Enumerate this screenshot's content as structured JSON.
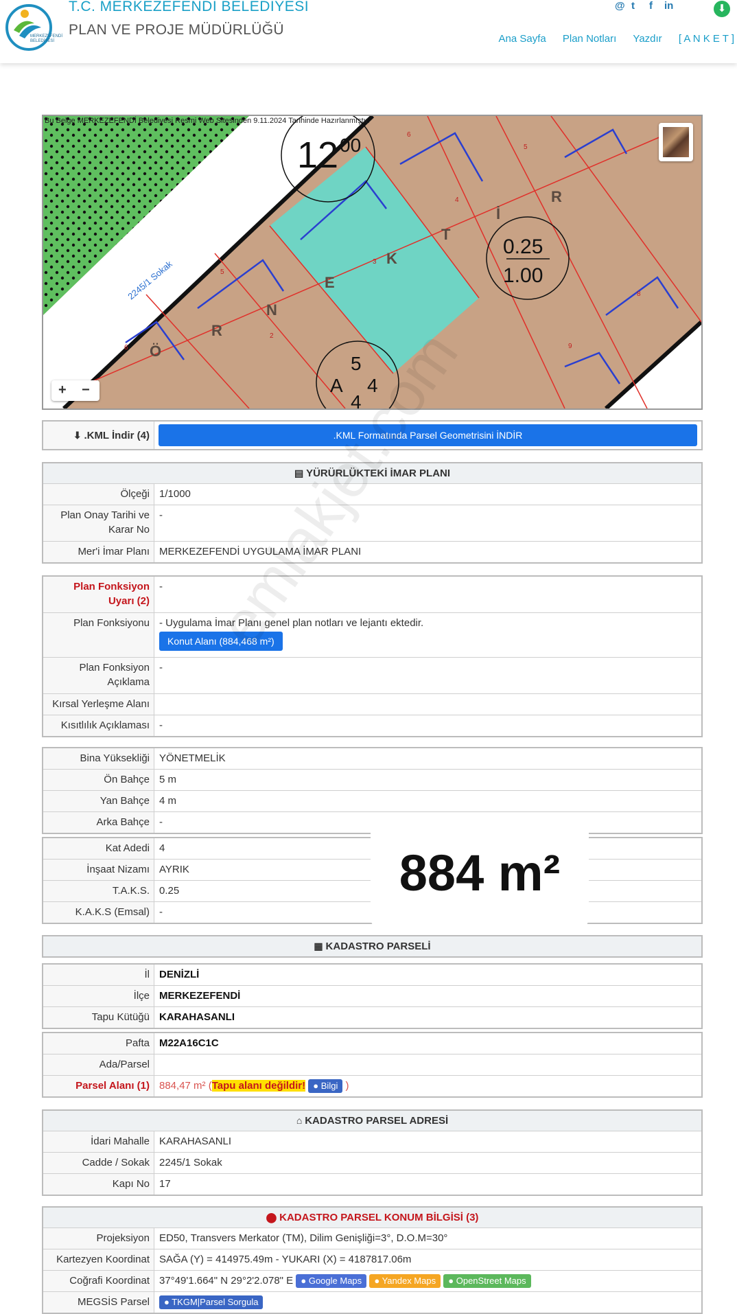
{
  "header": {
    "org_title": "T.C. MERKEZEFENDİ BELEDİYESİ",
    "org_subtitle": "PLAN VE PROJE MÜDÜRLÜĞÜ",
    "logo_text": "MERKEZEFENDİ BELEDİYESİ",
    "social": [
      "@",
      "t",
      "f",
      "in"
    ],
    "nav": [
      "Ana Sayfa",
      "Plan Notları",
      "Yazdır",
      "[ A N K E T ]"
    ]
  },
  "map": {
    "note": "Bu Belge MERKEZEFENDİ Belediyesi Resmi Web Sitesinden 9.11.2024 Tarihinde Hazırlanmıştır.",
    "street_label": "2245/1 Sokak",
    "road_width": "12",
    "road_width_sup": "00",
    "taks": "0.25",
    "kaks": "1.00",
    "block_top": "5",
    "block_left": "A",
    "block_right": "4",
    "block_bottom": "4",
    "letters": [
      "Ö",
      "R",
      "N",
      "E",
      "K",
      "T",
      "İ",
      "R"
    ],
    "parcel_numbers": [
      "6",
      "5",
      "2",
      "3",
      "4",
      "6",
      "5",
      "8",
      "9"
    ],
    "zoom_in": "+",
    "zoom_out": "−"
  },
  "kml": {
    "label": ".KML İndir (4)",
    "button": ".KML Formatında Parsel Geometrisini İNDİR"
  },
  "imar": {
    "title": "YÜRÜRLÜKTEKİ İMAR PLANI",
    "rows": [
      {
        "label": "Ölçeği",
        "value": "1/1000"
      },
      {
        "label": "Plan Onay Tarihi ve Karar No",
        "value": "-"
      },
      {
        "label": "Mer'i İmar Planı",
        "value": "MERKEZEFENDİ UYGULAMA İMAR PLANI"
      }
    ]
  },
  "fonksiyon": {
    "warn_label": "Plan Fonksiyon Uyarı (2)",
    "warn_value": "-",
    "func_label": "Plan Fonksiyonu",
    "func_value": "- Uygulama İmar Planı genel plan notları ve lejantı ektedir.",
    "func_button": "Konut Alanı (884,468 m²)",
    "rows": [
      {
        "label": "Plan Fonksiyon Açıklama",
        "value": "-"
      },
      {
        "label": "Kırsal Yerleşme Alanı",
        "value": ""
      },
      {
        "label": "Kısıtlılık Açıklaması",
        "value": "-"
      }
    ]
  },
  "yapi": {
    "rows1": [
      {
        "label": "Bina Yüksekliği",
        "value": "YÖNETMELİK"
      },
      {
        "label": "Ön Bahçe",
        "value": "5 m"
      },
      {
        "label": "Yan Bahçe",
        "value": "4 m"
      },
      {
        "label": "Arka Bahçe",
        "value": "-"
      }
    ],
    "rows2": [
      {
        "label": "Kat Adedi",
        "value": "4"
      },
      {
        "label": "İnşaat Nizamı",
        "value": "AYRIK"
      },
      {
        "label": "T.A.K.S.",
        "value": "0.25"
      },
      {
        "label": "K.A.K.S (Emsal)",
        "value": "-"
      }
    ]
  },
  "overlay_area": "884 m²",
  "kadastro": {
    "title": "KADASTRO PARSELİ",
    "rows1": [
      {
        "label": "İl",
        "value": "DENİZLİ"
      },
      {
        "label": "İlçe",
        "value": "MERKEZEFENDİ"
      },
      {
        "label": "Tapu Kütüğü",
        "value": "KARAHASANLI"
      }
    ],
    "pafta_label": "Pafta",
    "pafta_value": "M22A16C1C",
    "ada_label": "Ada/Parsel",
    "ada_value": "",
    "alan_label": "Parsel Alanı (1)",
    "alan_value": "884,47 m²",
    "alan_open": "(",
    "alan_warning": "Tapu alanı değildir!",
    "alan_info_btn": "Bilgi",
    "alan_close": ")"
  },
  "adres": {
    "title": "KADASTRO PARSEL ADRESİ",
    "rows": [
      {
        "label": "İdari Mahalle",
        "value": "KARAHASANLI"
      },
      {
        "label": "Cadde / Sokak",
        "value": "2245/1 Sokak"
      },
      {
        "label": "Kapı No",
        "value": "17"
      }
    ]
  },
  "konum": {
    "title": "KADASTRO PARSEL KONUM BİLGİSİ (3)",
    "rows": [
      {
        "label": "Projeksiyon",
        "value": "ED50, Transvers Merkator (TM), Dilim Genişliği=3°, D.O.M=30°"
      },
      {
        "label": "Kartezyen Koordinat",
        "value": "SAĞA (Y) = 414975.49m - YUKARI (X) = 4187817.06m"
      }
    ],
    "cografi_label": "Coğrafi Koordinat",
    "cografi_value": "37°49'1.664\" N 29°2'2.078\" E",
    "map_buttons": [
      {
        "label": "Google Maps",
        "color": "#4a6fd6"
      },
      {
        "label": "Yandex Maps",
        "color": "#f5a623"
      },
      {
        "label": "OpenStreet Maps",
        "color": "#5cb85c"
      }
    ],
    "megsis_label": "MEGSİS Parsel",
    "megsis_button": "TKGM|Parsel Sorgula"
  },
  "watermark": "emlakjet.com"
}
